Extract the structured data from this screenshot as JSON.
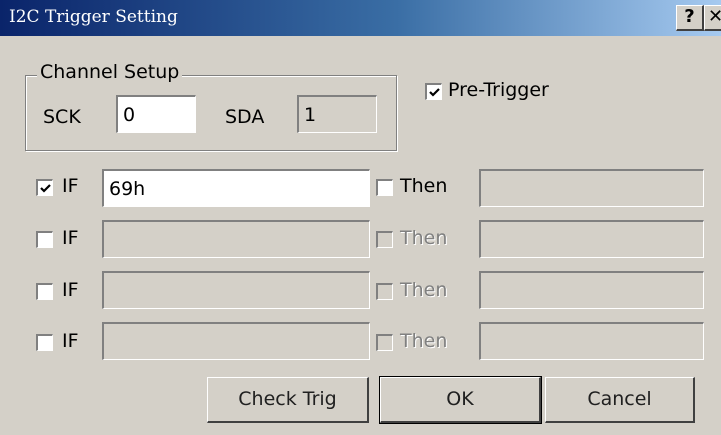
{
  "window": {
    "title": "I2C Trigger Setting",
    "help_label": "?",
    "close_label": "✕"
  },
  "channel_setup": {
    "legend": "Channel Setup",
    "sck_label": "SCK",
    "sck_value": "0",
    "sda_label": "SDA",
    "sda_value": "1"
  },
  "pre_trigger": {
    "label": "Pre-Trigger",
    "checked": true
  },
  "rows": [
    {
      "if_checked": true,
      "if_label": "IF",
      "if_value": "69h",
      "then_checked": false,
      "then_label": "Then",
      "then_value": "",
      "then_enabled": true
    },
    {
      "if_checked": false,
      "if_label": "IF",
      "if_value": "",
      "then_checked": false,
      "then_label": "Then",
      "then_value": "",
      "then_enabled": false
    },
    {
      "if_checked": false,
      "if_label": "IF",
      "if_value": "",
      "then_checked": false,
      "then_label": "Then",
      "then_value": "",
      "then_enabled": false
    },
    {
      "if_checked": false,
      "if_label": "IF",
      "if_value": "",
      "then_checked": false,
      "then_label": "Then",
      "then_value": "",
      "then_enabled": false
    }
  ],
  "buttons": {
    "check_trig": "Check Trig",
    "ok": "OK",
    "cancel": "Cancel"
  }
}
